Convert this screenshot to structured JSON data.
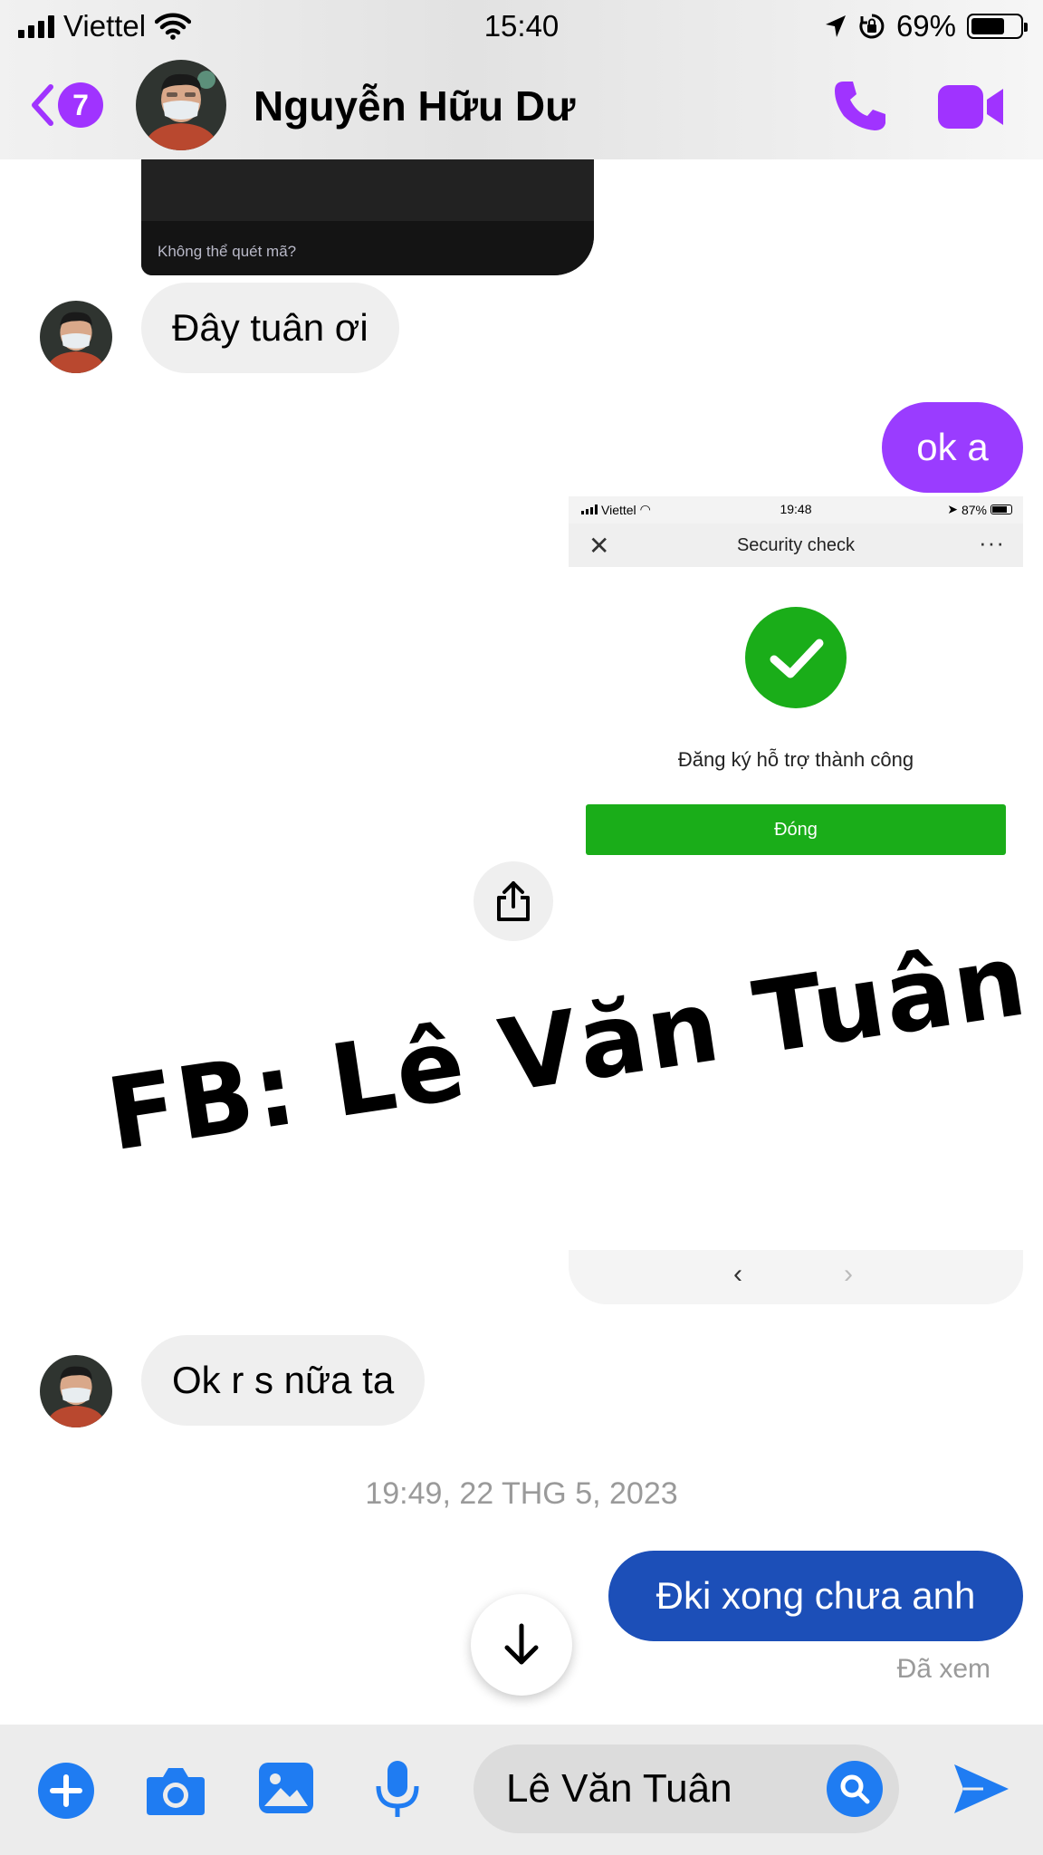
{
  "status_bar": {
    "carrier": "Viettel",
    "time": "15:40",
    "battery": "69%",
    "battery_level": 0.69
  },
  "header": {
    "back_badge": "7",
    "contact_name": "Nguyễn Hữu Dư",
    "icons": [
      "chevron-left-icon",
      "phone-icon",
      "video-camera-icon"
    ],
    "accent_color": "#a033ff"
  },
  "messages": {
    "qr_caption": "Không thể quét mã?",
    "msg1": "Đây tuân ơi",
    "msg2": "ok a",
    "msg3": "Ok r s nữa ta",
    "timestamp": "19:49, 22 THG 5, 2023",
    "msg4": "Đki xong chưa anh",
    "seen": "Đã xem",
    "out_colors": [
      "#9a3cff",
      "#1c4fb8"
    ]
  },
  "screenshot": {
    "carrier": "Viettel",
    "time": "19:48",
    "battery": "87%",
    "title": "Security check",
    "success_text": "Đăng ký hỗ trợ thành công",
    "close_label": "Đóng",
    "success_color": "#1aad19"
  },
  "watermark": "FB: Lê Văn Tuân",
  "composer": {
    "input_value": "Lê Văn Tuân",
    "icons": [
      "plus-icon",
      "camera-icon",
      "image-icon",
      "microphone-icon",
      "search-icon",
      "send-icon"
    ],
    "icon_color": "#1f7cf2"
  }
}
